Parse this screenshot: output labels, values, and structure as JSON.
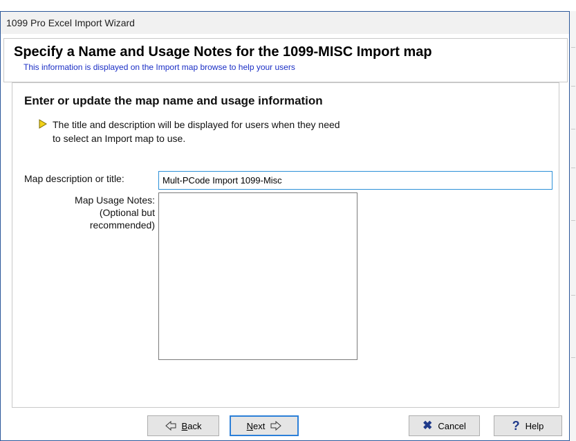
{
  "window": {
    "title": "1099 Pro Excel Import Wizard"
  },
  "header": {
    "title": "Specify a Name and Usage Notes for the 1099-MISC Import map",
    "subtitle": "This information is displayed on the Import map browse to help your users"
  },
  "main": {
    "heading": "Enter or update the map name and usage information",
    "note": "The title and description will be displayed for users when they need to select an Import map to use.",
    "note_icon": "yellow-triangle-arrow-icon",
    "title_field": {
      "label": "Map description or title:",
      "value": "Mult-PCode Import 1099-Misc"
    },
    "notes_field": {
      "label_lines": [
        "Map Usage Notes:",
        "(Optional but",
        "recommended)"
      ],
      "value": ""
    }
  },
  "footer": {
    "back": {
      "mnemonic": "B",
      "rest": "ack",
      "icon": "left-arrow-outline-icon"
    },
    "next": {
      "mnemonic": "N",
      "rest": "ext",
      "icon": "right-arrow-outline-icon"
    },
    "cancel": {
      "label": "Cancel",
      "icon": "close-x-icon"
    },
    "help": {
      "label": "Help",
      "icon": "question-mark-icon"
    }
  },
  "colors": {
    "window_border": "#2b579a",
    "subtitle_text": "#1a2ec5",
    "focus_border": "#2b8fd8",
    "note_arrow_fill": "#f2d21b",
    "icon_blue": "#1f3a8a"
  }
}
